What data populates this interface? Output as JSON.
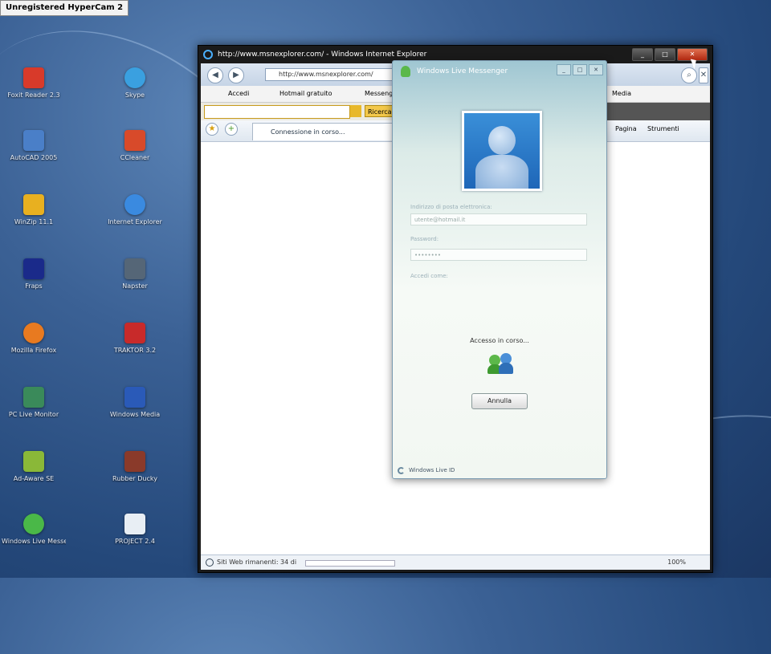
{
  "hypercam_label": "Unregistered HyperCam 2",
  "desktop_icons": [
    {
      "label": "Foxit Reader 2.3",
      "color": "#d83a2a"
    },
    {
      "label": "AutoCAD 2005",
      "color": "#4a7fc8"
    },
    {
      "label": "WinZip 11.1",
      "color": "#e8b020"
    },
    {
      "label": "Fraps",
      "color": "#1a2a8a"
    },
    {
      "label": "Mozilla Firefox",
      "color": "#e87a20"
    },
    {
      "label": "PC Live Monitor",
      "color": "#3a8a5a"
    },
    {
      "label": "Ad-Aware SE",
      "color": "#8ab838"
    },
    {
      "label": "Windows Live Messenger",
      "color": "#4ab848"
    },
    {
      "label": "Skype",
      "color": "#3aa0e0"
    },
    {
      "label": "CCleaner",
      "color": "#d84a2a"
    },
    {
      "label": "Internet Explorer",
      "color": "#3a8ae0"
    },
    {
      "label": "Napster",
      "color": "#556677"
    },
    {
      "label": "TRAKTOR 3.2",
      "color": "#c82a2a"
    },
    {
      "label": "Windows Media",
      "color": "#2a5ab8"
    },
    {
      "label": "Rubber Ducky",
      "color": "#8a3a2a"
    },
    {
      "label": "PROJECT 2.4",
      "color": "#e8eef4"
    }
  ],
  "ie": {
    "title": "http://www.msnexplorer.com/ - Windows Internet Explorer",
    "address": "http://www.msnexplorer.com/",
    "links": [
      "Accedi",
      "Hotmail gratuito",
      "Messenger",
      "Media"
    ],
    "search_go": "Ricerca",
    "tab_label": "Connessione in corso...",
    "right_tools": [
      "Pagina",
      "Strumenti"
    ],
    "status_text": "Siti Web rimanenti: 34 di",
    "zoom": "100%"
  },
  "msn": {
    "title": "Windows Live Messenger",
    "email_label": "Indirizzo di posta elettronica:",
    "email_value": "utente@hotmail.it",
    "password_label": "Password:",
    "password_value": "••••••••",
    "signin_status": "Accedi come:",
    "status_message": "Accesso in corso...",
    "cancel_button": "Annulla",
    "footer": "Windows Live ID"
  }
}
